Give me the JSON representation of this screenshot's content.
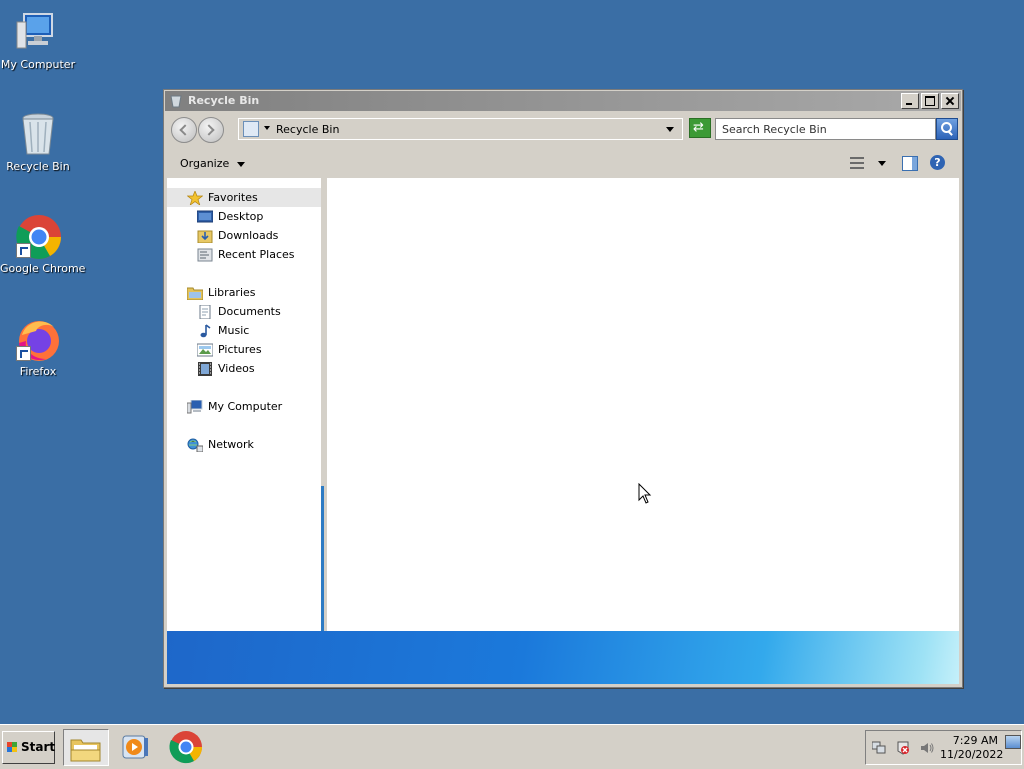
{
  "desktop": {
    "icons": [
      {
        "label": "My Computer",
        "icon": "computer-icon"
      },
      {
        "label": "Recycle Bin",
        "icon": "recycle-bin-icon"
      },
      {
        "label": "Google Chrome",
        "icon": "chrome-icon"
      },
      {
        "label": "Firefox",
        "icon": "firefox-icon"
      }
    ]
  },
  "window": {
    "title": "Recycle Bin",
    "address": "Recycle Bin",
    "search_placeholder": "Search Recycle Bin",
    "organize_label": "Organize"
  },
  "navpane": {
    "favorites": "Favorites",
    "favorites_items": [
      "Desktop",
      "Downloads",
      "Recent Places"
    ],
    "libraries": "Libraries",
    "libraries_items": [
      "Documents",
      "Music",
      "Pictures",
      "Videos"
    ],
    "computer": "My Computer",
    "network": "Network"
  },
  "taskbar": {
    "start_label": "Start",
    "clock_time": "7:29 AM",
    "clock_date": "11/20/2022"
  },
  "colors": {
    "desktop": "#3a6ea5",
    "chrome_face": "#d4d0c8",
    "accent_blue": "#2d7bc4"
  }
}
